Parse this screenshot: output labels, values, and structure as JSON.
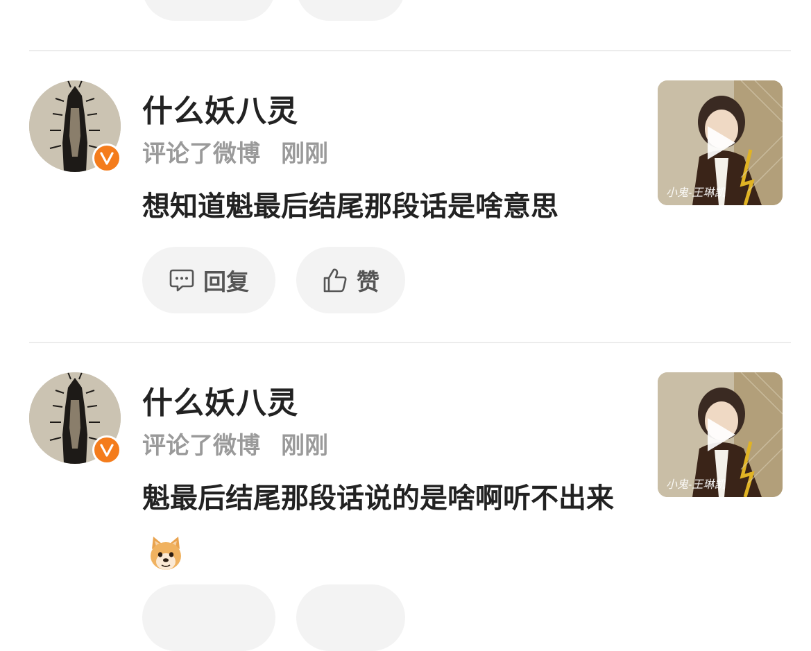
{
  "actions": {
    "reply_label": "回复",
    "like_label": "赞"
  },
  "comments": [
    {
      "username": "什么妖八灵",
      "action": "评论了微博",
      "time": "刚刚",
      "text": "想知道魁最后结尾那段话是啥意思",
      "thumb_caption": "小鬼-王琳凯",
      "badge": "V"
    },
    {
      "username": "什么妖八灵",
      "action": "评论了微博",
      "time": "刚刚",
      "text": "魁最后结尾那段话说的是啥啊听不出来",
      "emoji": "doge-emoji",
      "thumb_caption": "小鬼-王琳凯",
      "badge": "V"
    }
  ],
  "colors": {
    "badge": "#f47c1c",
    "pill_bg": "#f3f3f3",
    "meta": "#9a9a9a",
    "divider": "#ececec"
  }
}
